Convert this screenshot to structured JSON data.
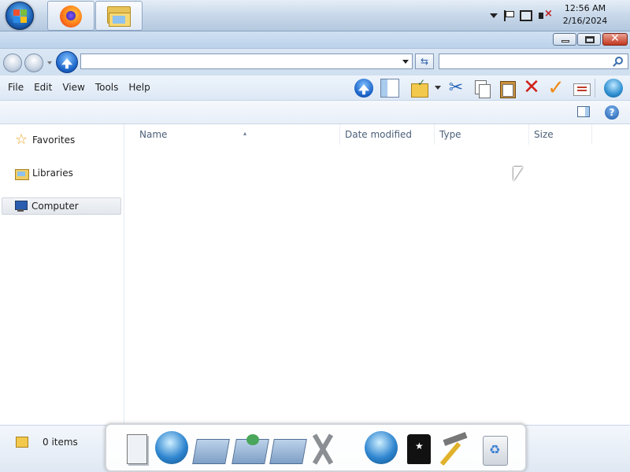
{
  "taskbar": {
    "clock": {
      "time": "12:56 AM",
      "date": "2/16/2024"
    },
    "pinned": [
      {
        "name": "Firefox",
        "icon": "firefox-icon"
      },
      {
        "name": "Windows Explorer",
        "icon": "explorer-icon"
      }
    ],
    "tray_icons": [
      "show-hidden-icons",
      "action-center-flag-icon",
      "network-icon",
      "volume-muted-icon"
    ]
  },
  "window": {
    "address": {
      "value": ""
    },
    "search": {
      "placeholder": ""
    },
    "menu": [
      "File",
      "Edit",
      "View",
      "Tools",
      "Help"
    ],
    "toolbar_icons": [
      "up-icon",
      "preview-pane-icon",
      "folder-options-icon",
      "dropdown-icon",
      "cut-icon",
      "copy-icon",
      "paste-icon",
      "delete-icon",
      "checkmark-icon",
      "properties-icon",
      "internet-icon"
    ]
  },
  "sidebar": {
    "items": [
      {
        "label": "Favorites",
        "icon": "star-icon",
        "selected": false
      },
      {
        "label": "Libraries",
        "icon": "libraries-icon",
        "selected": false
      },
      {
        "label": "Computer",
        "icon": "computer-icon",
        "selected": true
      }
    ]
  },
  "file_list": {
    "columns": [
      "Name",
      "Date modified",
      "Type",
      "Size"
    ],
    "rows": []
  },
  "status": {
    "text": "0 items"
  },
  "dock": {
    "icons": [
      "document-icon",
      "network-globe-icon",
      "folder-icon",
      "folder-green-icon",
      "folder-icon",
      "tools-icon",
      "globe-icon",
      "tshirt-icon",
      "hammer-icon",
      "recycle-bin-icon"
    ]
  },
  "colors": {
    "accent": "#1c64c8",
    "close": "#c2361f",
    "taskbar": "#c8d8ea"
  }
}
